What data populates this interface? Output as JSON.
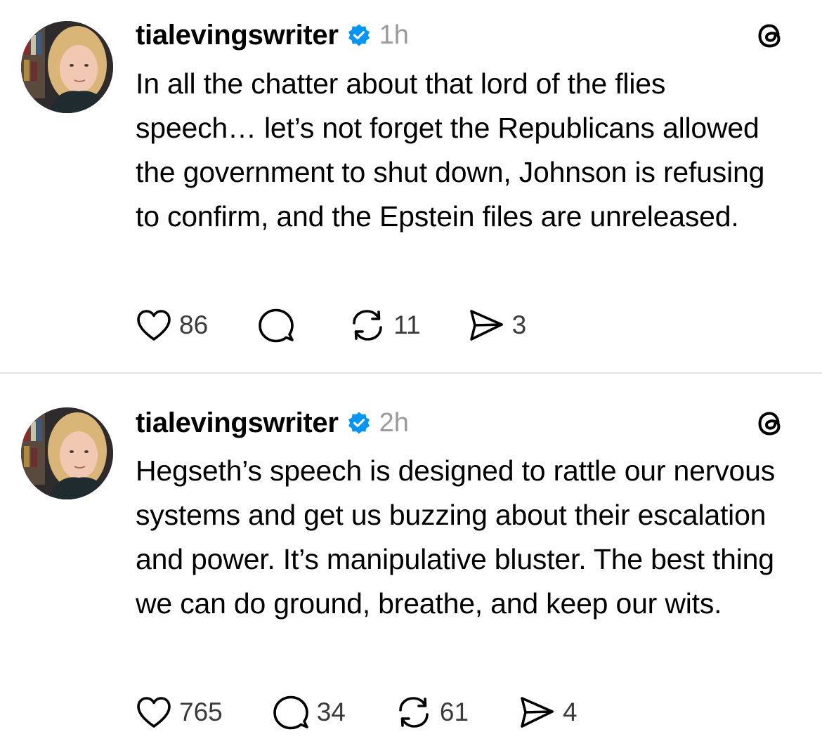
{
  "posts": [
    {
      "username": "tialevingswriter",
      "time": "1h",
      "text": "In all the chatter about that lord of the flies speech… let’s not forget the Republicans allowed the government to shut down, Johnson is refusing to confirm, and the Epstein files are unreleased.",
      "likes": "86",
      "replies": "",
      "reposts": "11",
      "shares": "3"
    },
    {
      "username": "tialevingswriter",
      "time": "2h",
      "text": "Hegseth’s speech is designed to rattle our nervous systems and get us buzzing about their escalation and power. It’s manipulative bluster. The best thing we can do ground, breathe, and keep our wits.",
      "likes": "765",
      "replies": "34",
      "reposts": "61",
      "shares": "4"
    }
  ],
  "icons": {
    "verified": "verified-badge-icon",
    "threads": "threads-logo-icon",
    "like": "heart-icon",
    "reply": "comment-bubble-icon",
    "repost": "repost-arrows-icon",
    "share": "send-icon"
  },
  "colors": {
    "verified_badge": "#0095f6",
    "timestamp": "#9a9a9a",
    "divider": "#e2e2e2"
  }
}
